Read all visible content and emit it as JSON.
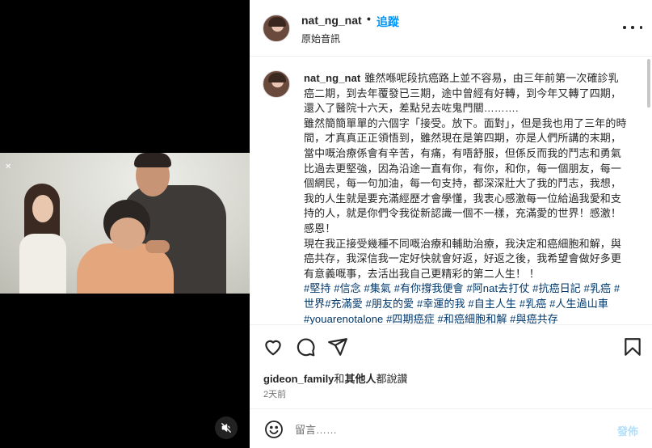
{
  "header": {
    "username": "nat_ng_nat",
    "separator": "•",
    "follow_label": "追蹤",
    "audio_label": "原始音訊"
  },
  "media": {
    "side_mark": "✕"
  },
  "caption": {
    "username": "nat_ng_nat",
    "paragraph1": "雖然喺呢段抗癌路上並不容易，由三年前第一次確診乳癌二期，到去年覆發已三期，途中曾經有好轉，到今年又轉了四期，還入了醫院十六天，差點兒去咗鬼門關……….",
    "paragraph2": "雖然簡簡單單的六個字「接受。放下。面對」，但是我也用了三年的時間，才真真正正領悟到，雖然現在是第四期，亦是人們所講的末期，當中嘅治療係會有辛苦，有痛，有唔舒服，但係反而我的鬥志和勇氣比過去更堅強，因為沿途一直有你，有你，和你，每一個朋友，每一個網民，每一句加油，每一句支持，都深深壯大了我的鬥志，我想，我的人生就是要充滿經歷才會學懂，我衷心感激每一位給過我愛和支持的人，就是你們令我從新認識一個不一樣，充滿愛的世界！感激！感恩！",
    "paragraph3": "現在我正接受幾種不同嘅治療和輔助治療，我決定和癌細胞和解，與癌共存，我深信我一定好快就會好返，好返之後，我希望會做好多更有意義嘅事，去活出我自己更精彩的第二人生！ ！",
    "hashtags": "#堅持 #信念 #集氣 #有你撐我便會 #阿nat去打仗 #抗癌日記 #乳癌 #世界#充滿愛 #朋友的愛 #幸運的我 #自主人生 #乳癌 #人生過山車 #youarenotalone #四期癌症 #和癌細胞和解 #與癌共存"
  },
  "likes": {
    "first_user": "gideon_family",
    "connector": "和",
    "others": "其他人",
    "suffix": "都說讚"
  },
  "time_ago": "2天前",
  "comment": {
    "placeholder": "留言……",
    "post_label": "發佈"
  },
  "colors": {
    "accent": "#0095f6",
    "hashtag": "#00376b",
    "post_disabled": "#b2dffc"
  },
  "icons": [
    "heart-icon",
    "comment-icon",
    "share-icon",
    "bookmark-icon",
    "emoji-icon",
    "mute-icon",
    "more-icon"
  ]
}
